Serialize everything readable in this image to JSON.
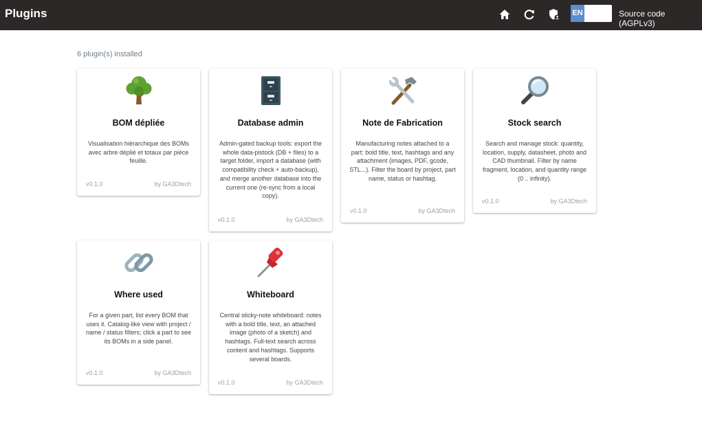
{
  "header": {
    "title": "Plugins",
    "home_icon": "home-icon",
    "refresh_icon": "refresh-icon",
    "admin_icon": "shield-user-icon",
    "language": "EN",
    "source_link": "Source code (AGPLv3)"
  },
  "main": {
    "installed_count": "6 plugin(s) installed",
    "plugins": [
      {
        "icon": "tree-icon",
        "title": "BOM dépliée",
        "description": "Visualisation hiérarchique des BOMs avec arbre déplié et totaux par pièce feuille.",
        "version": "v0.1.0",
        "author": "by GA3Dtech"
      },
      {
        "icon": "file-cabinet-icon",
        "title": "Database admin",
        "description": "Admin-gated backup tools: export the whole data-pistock (DB + files) to a target folder, import a database (with compatibility check + auto-backup), and merge another database into the current one (re-sync from a local copy).",
        "version": "v0.1.0",
        "author": "by GA3Dtech"
      },
      {
        "icon": "hammer-and-wrench-icon",
        "title": "Note de Fabrication",
        "description": "Manufacturing notes attached to a part: bold title, text, hashtags and any attachment (images, PDF, gcode, STL...). Filter the board by project, part name, status or hashtag.",
        "version": "v0.1.0",
        "author": "by GA3Dtech"
      },
      {
        "icon": "magnifying-glass-icon",
        "title": "Stock search",
        "description": "Search and manage stock: quantity, location, supply, datasheet, photo and CAD thumbnail. Filter by name fragment, location, and quantity range (0 .. infinity).",
        "version": "v0.1.0",
        "author": "by GA3Dtech"
      },
      {
        "icon": "link-icon",
        "title": "Where used",
        "description": "For a given part, list every BOM that uses it. Catalog-like view with project / name / status filters; click a part to see its BOMs in a side panel.",
        "version": "v0.1.0",
        "author": "by GA3Dtech"
      },
      {
        "icon": "pushpin-icon",
        "title": "Whiteboard",
        "description": "Central sticky-note whiteboard: notes with a bold title, text, an attached image (photo of a sketch) and hashtags. Full-text search across content and hashtags. Supports several boards.",
        "version": "v0.1.0",
        "author": "by GA3Dtech"
      }
    ]
  }
}
